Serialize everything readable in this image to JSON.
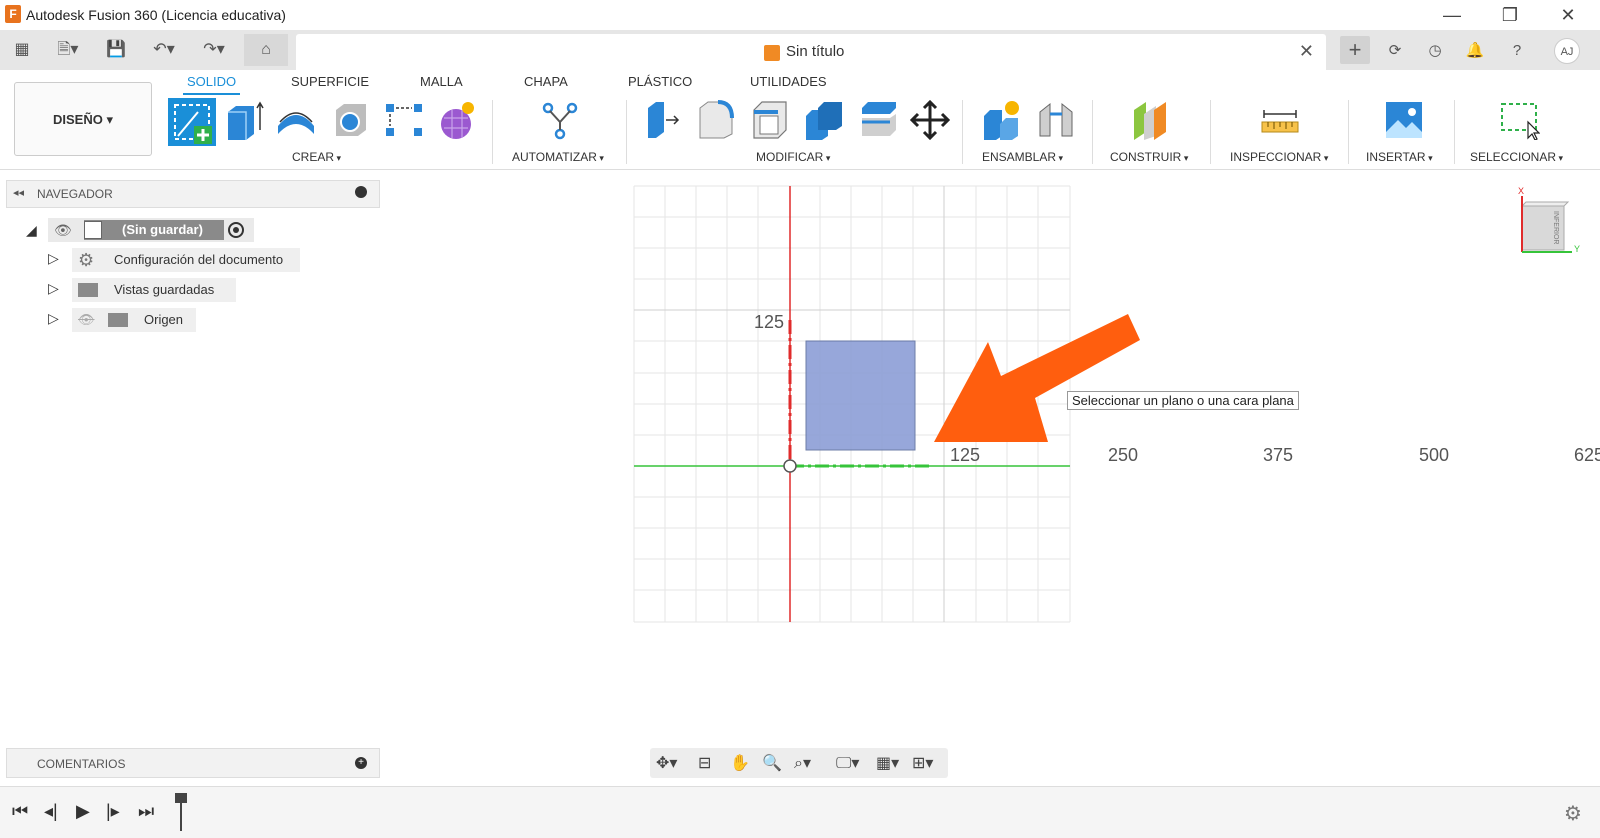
{
  "window": {
    "title": "Autodesk Fusion 360 (Licencia educativa)",
    "logo_letter": "F"
  },
  "document": {
    "tab_name": "Sin título"
  },
  "user": {
    "initials": "AJ"
  },
  "workspace": {
    "label": "DISEÑO"
  },
  "ribbon_tabs": [
    {
      "label": "SOLIDO",
      "active": true
    },
    {
      "label": "SUPERFICIE",
      "active": false
    },
    {
      "label": "MALLA",
      "active": false
    },
    {
      "label": "CHAPA",
      "active": false
    },
    {
      "label": "PLÁSTICO",
      "active": false
    },
    {
      "label": "UTILIDADES",
      "active": false
    }
  ],
  "ribbon_groups": {
    "crear": "CREAR",
    "automatizar": "AUTOMATIZAR",
    "modificar": "MODIFICAR",
    "ensamblar": "ENSAMBLAR",
    "construir": "CONSTRUIR",
    "inspeccionar": "INSPECCIONAR",
    "insertar": "INSERTAR",
    "seleccionar": "SELECCIONAR"
  },
  "browser": {
    "header": "NAVEGADOR",
    "root": "(Sin guardar)",
    "items": [
      {
        "label": "Configuración del documento",
        "icon": "gear-icon"
      },
      {
        "label": "Vistas guardadas",
        "icon": "folder-icon"
      },
      {
        "label": "Origen",
        "icon": "folder-icon"
      }
    ]
  },
  "comments": {
    "header": "COMENTARIOS"
  },
  "viewport": {
    "tooltip": "Seleccionar un plano o una cara plana",
    "axis_labels": {
      "y_125": "125",
      "x_125": "125",
      "x_250": "250",
      "x_375": "375",
      "x_500": "500",
      "x_625": "625"
    },
    "viewcube_face": "INFERIOR",
    "viewcube_x": "X",
    "viewcube_y": "Y",
    "colors": {
      "x_axis": "#e02b2b",
      "y_axis": "#36c43a",
      "plane_fill": "#8c9ed6",
      "arrow": "#ff5e0e",
      "accent": "#1a8fd8"
    }
  }
}
